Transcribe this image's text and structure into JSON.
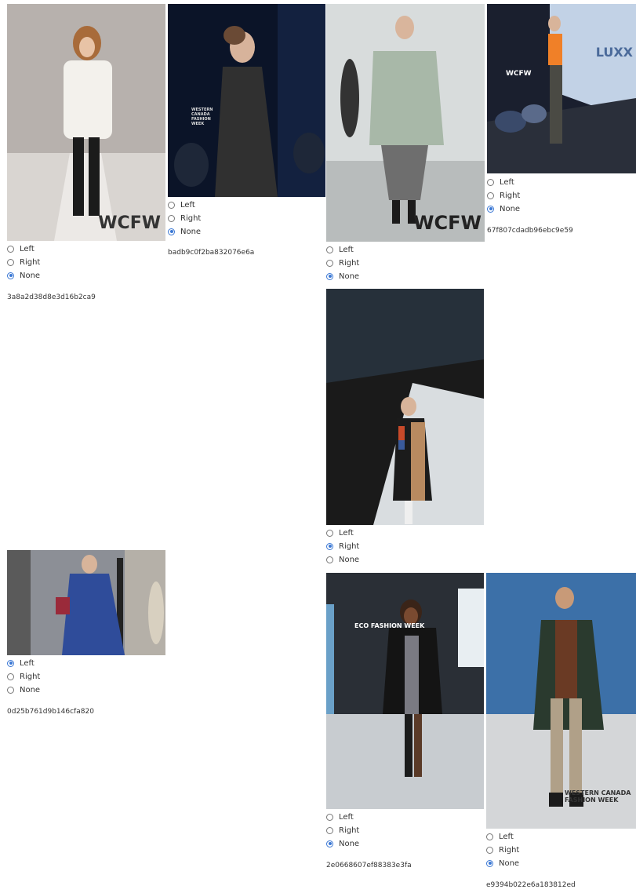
{
  "options": [
    "Left",
    "Right",
    "None"
  ],
  "cards": [
    {
      "id": "3a8a2d38d8e3d16b2ca9",
      "selected": "None",
      "watermark": "WCFW"
    },
    {
      "id": "badb9c0f2ba832076e6a",
      "selected": "None",
      "watermark": "WESTERN CANADA FASHION WEEK"
    },
    {
      "id": "",
      "selected": "None",
      "watermark": "WCFW"
    },
    {
      "id": "67f807cdadb96ebc9e59",
      "selected": "None",
      "watermark": "LUXX"
    },
    {
      "id": "",
      "selected": "Right",
      "watermark": ""
    },
    {
      "id": "0d25b761d9b146cfa820",
      "selected": "Left",
      "watermark": ""
    },
    {
      "id": "2e0668607ef88383e3fa",
      "selected": "None",
      "watermark": "ECO FASHION WEEK"
    },
    {
      "id": "e9394b022e6a183812ed",
      "selected": "None",
      "watermark": "WESTERN CANADA FASHION WEEK"
    }
  ],
  "colors": {
    "radio_accent": "#3b78d4"
  }
}
